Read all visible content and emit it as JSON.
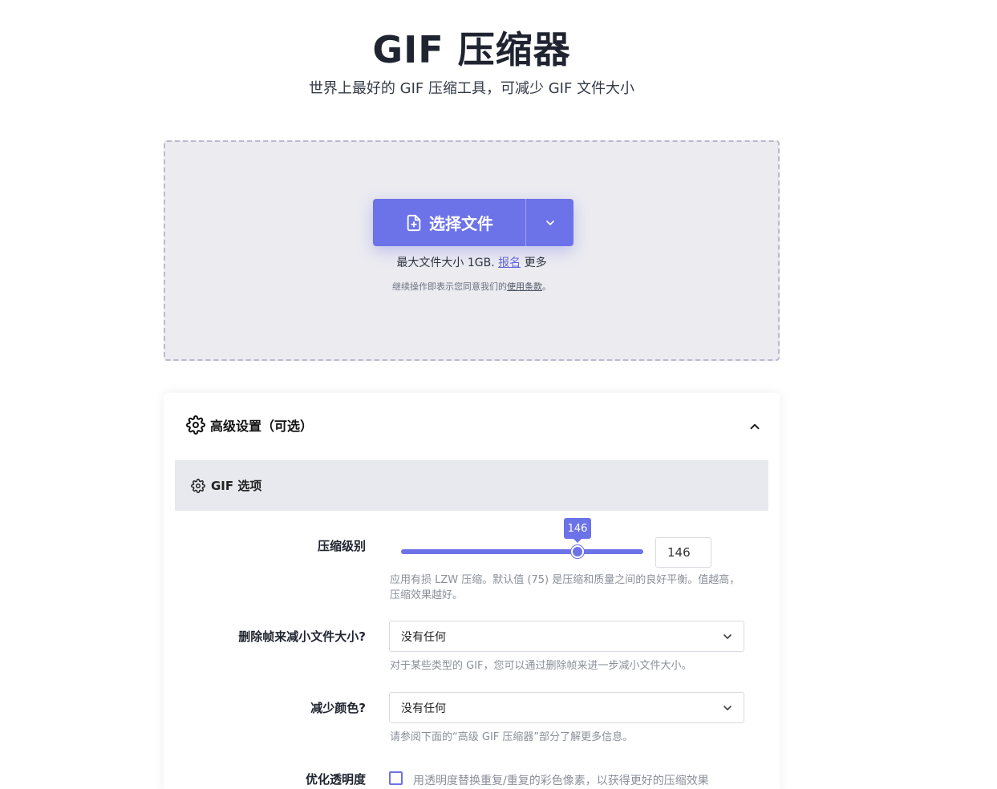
{
  "header": {
    "title": "GIF 压缩器",
    "subtitle": "世界上最好的 GIF 压缩工具，可减少 GIF 文件大小"
  },
  "upload": {
    "choose_label": "选择文件",
    "size_note_prefix": "最大文件大小 1GB.",
    "signup_link": "报名",
    "size_note_suffix": "更多",
    "terms_prefix": "继续操作即表示您同意我们的",
    "terms_link": "使用条款",
    "terms_suffix": "。"
  },
  "settings": {
    "title": "高级设置（可选）",
    "section_title": "GIF 选项",
    "compression": {
      "label": "压缩级别",
      "value": 146,
      "value_text": "146",
      "help": "应用有损 LZW 压缩。默认值 (75) 是压缩和质量之间的良好平衡。值越高，压缩效果越好。"
    },
    "drop_frames": {
      "label": "删除帧来减小文件大小?",
      "selected": "没有任何",
      "help": "对于某些类型的 GIF，您可以通过删除帧来进一步减小文件大小。"
    },
    "reduce_colors": {
      "label": "减少颜色?",
      "selected": "没有任何",
      "help": "请参阅下面的“高级 GIF 压缩器”部分了解更多信息。"
    },
    "transparency": {
      "label": "优化透明度",
      "checkbox_label": "用透明度替换重复/重复的彩色像素，以获得更好的压缩效果"
    }
  },
  "colors": {
    "accent": "#6c72e8",
    "dropzone_bg": "#ebebf0",
    "section_bg": "#e7e9ee"
  },
  "icons": {
    "file_add": "file-plus-icon",
    "dropdown": "chevron-down-icon",
    "settings": "gear-icon",
    "collapse": "chevron-up-icon"
  }
}
